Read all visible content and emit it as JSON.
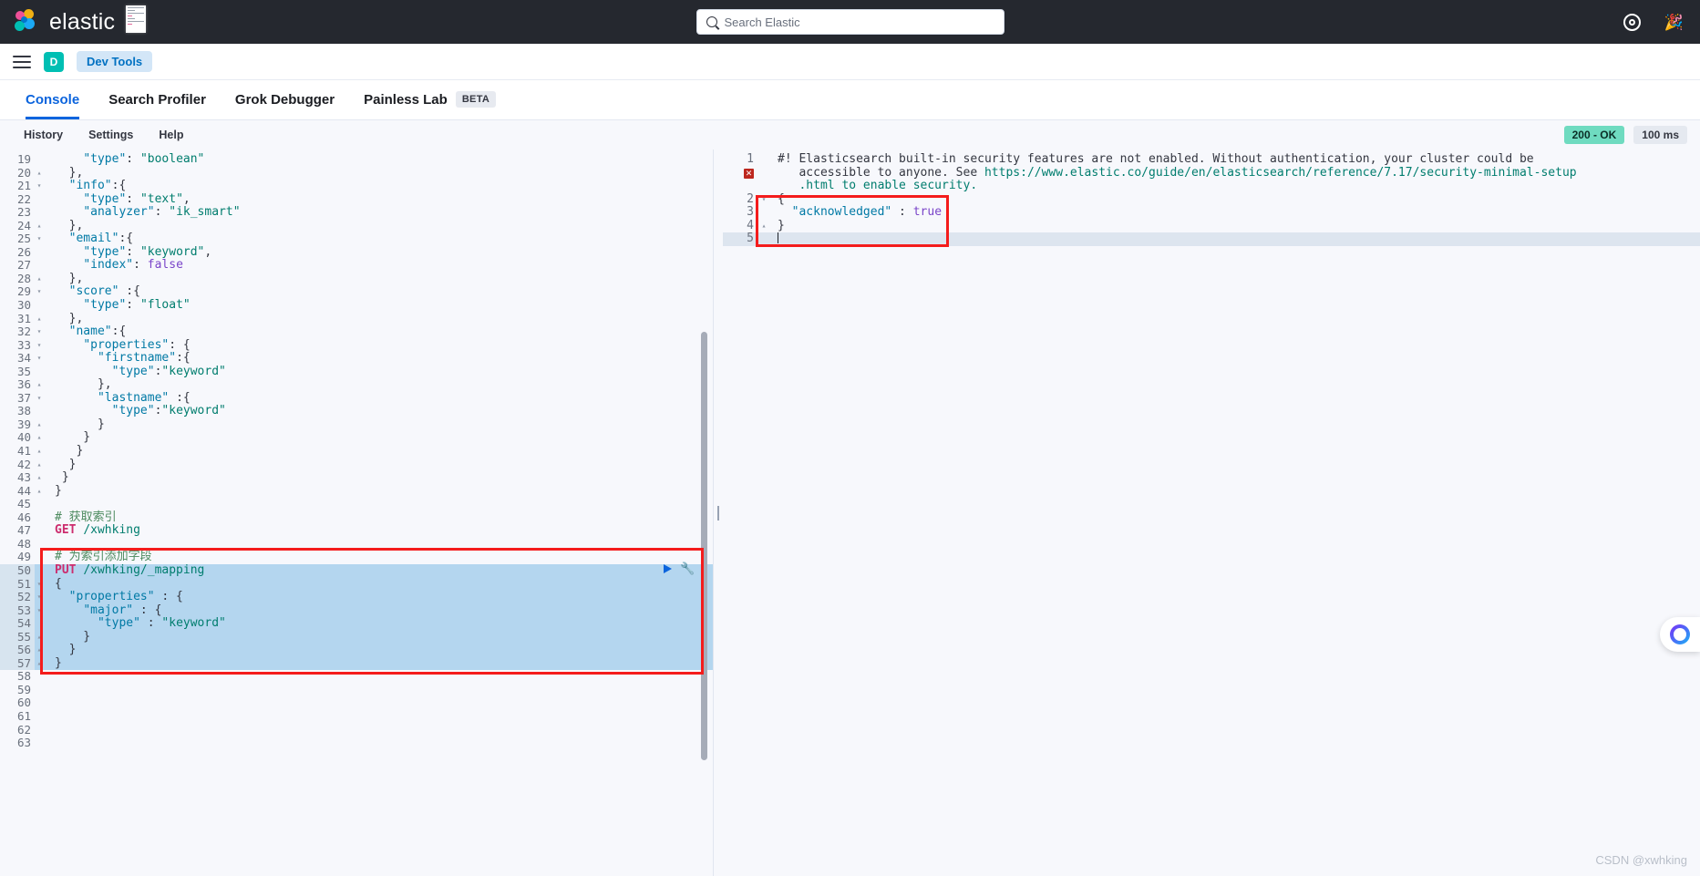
{
  "topbar": {
    "brand": "elastic",
    "search_placeholder": "Search Elastic",
    "search_value": "",
    "icons": {
      "help": "help-circle-icon",
      "party": "🎉"
    }
  },
  "navbar": {
    "menu_icon": "hamburger-menu-icon",
    "space_initial": "D",
    "breadcrumb": "Dev Tools"
  },
  "apptabs": [
    {
      "label": "Console",
      "active": true,
      "badge": ""
    },
    {
      "label": "Search Profiler",
      "active": false,
      "badge": ""
    },
    {
      "label": "Grok Debugger",
      "active": false,
      "badge": ""
    },
    {
      "label": "Painless Lab",
      "active": false,
      "badge": "BETA"
    }
  ],
  "console_toolbar": {
    "items": [
      "History",
      "Settings",
      "Help"
    ],
    "status_code": "200 - OK",
    "latency": "100 ms"
  },
  "editor": {
    "first_line_number": 19,
    "active_line": 50,
    "highlight_from": 50,
    "highlight_to": 57,
    "lines": [
      {
        "n": 19,
        "fold": "",
        "html": "<span class='p'>    </span><span class='k'>\"type\"</span><span class='p'>: </span><span class='s'>\"boolean\"</span>"
      },
      {
        "n": 20,
        "fold": "▴",
        "html": "<span class='p'>  },</span>"
      },
      {
        "n": 21,
        "fold": "▾",
        "html": "<span class='p'>  </span><span class='k'>\"info\"</span><span class='p'>:{</span>"
      },
      {
        "n": 22,
        "fold": "",
        "html": "<span class='p'>    </span><span class='k'>\"type\"</span><span class='p'>: </span><span class='s'>\"text\"</span><span class='p'>,</span>"
      },
      {
        "n": 23,
        "fold": "",
        "html": "<span class='p'>    </span><span class='k'>\"analyzer\"</span><span class='p'>: </span><span class='s'>\"ik_smart\"</span>"
      },
      {
        "n": 24,
        "fold": "▴",
        "html": "<span class='p'>  },</span>"
      },
      {
        "n": 25,
        "fold": "▾",
        "html": "<span class='p'>  </span><span class='k'>\"email\"</span><span class='p'>:{</span>"
      },
      {
        "n": 26,
        "fold": "",
        "html": "<span class='p'>    </span><span class='k'>\"type\"</span><span class='p'>: </span><span class='s'>\"keyword\"</span><span class='p'>,</span>"
      },
      {
        "n": 27,
        "fold": "",
        "html": "<span class='p'>    </span><span class='k'>\"index\"</span><span class='p'>: </span><span class='bool'>false</span>"
      },
      {
        "n": 28,
        "fold": "▴",
        "html": "<span class='p'>  },</span>"
      },
      {
        "n": 29,
        "fold": "▾",
        "html": "<span class='p'>  </span><span class='k'>\"score\"</span><span class='p'> :{</span>"
      },
      {
        "n": 30,
        "fold": "",
        "html": "<span class='p'>    </span><span class='k'>\"type\"</span><span class='p'>: </span><span class='s'>\"float\"</span>"
      },
      {
        "n": 31,
        "fold": "▴",
        "html": "<span class='p'>  },</span>"
      },
      {
        "n": 32,
        "fold": "▾",
        "html": "<span class='p'>  </span><span class='k'>\"name\"</span><span class='p'>:{</span>"
      },
      {
        "n": 33,
        "fold": "▾",
        "html": "<span class='p'>    </span><span class='k'>\"properties\"</span><span class='p'>: {</span>"
      },
      {
        "n": 34,
        "fold": "▾",
        "html": "<span class='p'>      </span><span class='k'>\"firstname\"</span><span class='p'>:{</span>"
      },
      {
        "n": 35,
        "fold": "",
        "html": "<span class='p'>        </span><span class='k'>\"type\"</span><span class='p'>:</span><span class='s'>\"keyword\"</span>"
      },
      {
        "n": 36,
        "fold": "▴",
        "html": "<span class='p'>      },</span>"
      },
      {
        "n": 37,
        "fold": "▾",
        "html": "<span class='p'>      </span><span class='k'>\"lastname\"</span><span class='p'> :{</span>"
      },
      {
        "n": 38,
        "fold": "",
        "html": "<span class='p'>        </span><span class='k'>\"type\"</span><span class='p'>:</span><span class='s'>\"keyword\"</span>"
      },
      {
        "n": 39,
        "fold": "▴",
        "html": "<span class='p'>      }</span>"
      },
      {
        "n": 40,
        "fold": "▴",
        "html": "<span class='p'>    }</span>"
      },
      {
        "n": 41,
        "fold": "▴",
        "html": "<span class='p'>   }</span>"
      },
      {
        "n": 42,
        "fold": "▴",
        "html": "<span class='p'>  }</span>"
      },
      {
        "n": 43,
        "fold": "▴",
        "html": "<span class='p'> }</span>"
      },
      {
        "n": 44,
        "fold": "▴",
        "html": "<span class='p'>}</span>"
      },
      {
        "n": 45,
        "fold": "",
        "html": ""
      },
      {
        "n": 46,
        "fold": "",
        "html": "<span class='cm'># 获取索引</span>"
      },
      {
        "n": 47,
        "fold": "",
        "html": "<span class='meth'>GET</span> <span class='url'>/xwhking</span>"
      },
      {
        "n": 48,
        "fold": "",
        "html": ""
      },
      {
        "n": 49,
        "fold": "",
        "html": "<span class='cm'># 为索引添加字段</span>"
      },
      {
        "n": 50,
        "fold": "",
        "html": "<span class='meth'>PUT</span> <span class='url'>/xwhking/_mapping</span>"
      },
      {
        "n": 51,
        "fold": "▾",
        "html": "<span class='p'>{</span>"
      },
      {
        "n": 52,
        "fold": "▾",
        "html": "<span class='p'>  </span><span class='k'>\"properties\"</span><span class='p'> : {</span>"
      },
      {
        "n": 53,
        "fold": "▾",
        "html": "<span class='p'>    </span><span class='k'>\"major\"</span><span class='p'> : {</span>"
      },
      {
        "n": 54,
        "fold": "",
        "html": "<span class='p'>      </span><span class='k'>\"type\"</span><span class='p'> : </span><span class='s'>\"keyword\"</span>"
      },
      {
        "n": 55,
        "fold": "▴",
        "html": "<span class='p'>    }</span>"
      },
      {
        "n": 56,
        "fold": "▴",
        "html": "<span class='p'>  }</span>"
      },
      {
        "n": 57,
        "fold": "▴",
        "html": "<span class='p'>}</span>"
      },
      {
        "n": 58,
        "fold": "",
        "html": ""
      },
      {
        "n": 59,
        "fold": "",
        "html": ""
      },
      {
        "n": 60,
        "fold": "",
        "html": ""
      },
      {
        "n": 61,
        "fold": "",
        "html": ""
      },
      {
        "n": 62,
        "fold": "",
        "html": ""
      },
      {
        "n": 63,
        "fold": "",
        "html": ""
      }
    ],
    "run_action": {
      "play": "play-request-icon",
      "wrench": "open-docs-icon"
    }
  },
  "response": {
    "lines": [
      {
        "n": "1",
        "marker": "",
        "html": "<span class='p'>#! Elasticsearch built-in security features are not enabled. Without authentication, your cluster could be</span>"
      },
      {
        "n": "",
        "marker": "error",
        "html": "<span class='p'>   accessible to anyone. See </span><span class='url'>https://www.elastic.co/guide/en/elasticsearch/reference/7.17/security-minimal-setup</span>"
      },
      {
        "n": "",
        "marker": "",
        "html": "<span class='url'>   .html to enable security.</span>"
      },
      {
        "n": "2",
        "marker": "",
        "fold": "▾",
        "html": "<span class='p'>{</span>"
      },
      {
        "n": "3",
        "marker": "",
        "fold": "",
        "html": "<span class='p'>  </span><span class='k'>\"acknowledged\"</span><span class='p'> : </span><span class='bool'>true</span>"
      },
      {
        "n": "4",
        "marker": "",
        "fold": "▴",
        "html": "<span class='p'>}</span>"
      },
      {
        "n": "5",
        "marker": "",
        "fold": "",
        "html": ""
      }
    ]
  },
  "fab": {
    "label": "chat-assistant-icon"
  },
  "watermark": "CSDN @xwhking",
  "colors": {
    "brand_dark": "#25282f",
    "accent_blue": "#0b64dd",
    "teal": "#00bfb3",
    "ok_green": "#6fdbc0",
    "annotation_red": "#f41c1c",
    "selection_blue": "#b4d6ef"
  }
}
